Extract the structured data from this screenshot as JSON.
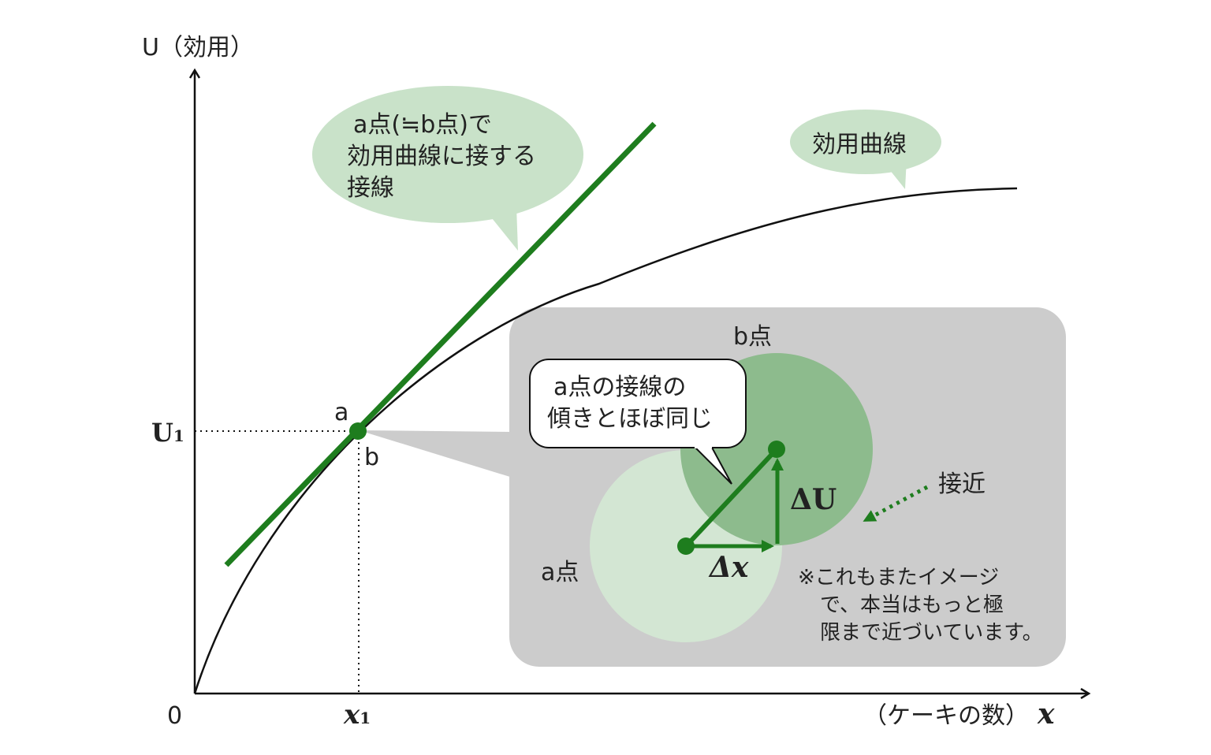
{
  "axes": {
    "y_label": "U（効用）",
    "x_label": "（ケーキの数）",
    "x_symbol": "x",
    "origin": "0",
    "u1_main": "U",
    "u1_sub": "1",
    "x1_main": "x",
    "x1_sub": "1"
  },
  "points": {
    "a": "a",
    "b": "b"
  },
  "callouts": {
    "tangent": [
      "a点(≒b点)で",
      "効用曲線に接する",
      "接線"
    ],
    "curve": "効用曲線",
    "slope": [
      "a点の接線の",
      "傾きとほぼ同じ"
    ]
  },
  "inset": {
    "b_point": "b点",
    "a_point": "a点",
    "delta_u": "ΔU",
    "delta_x": "Δx",
    "approach": "接近",
    "note": [
      "※これもまたイメージ",
      "で、本当はもっと極",
      "限まで近づいています。"
    ]
  },
  "colors": {
    "tangent_green": "#1e7d1e",
    "bubble_green": "#c9e2c9",
    "inset_gray": "#cccccc",
    "circle_b": "#8dbb8d",
    "circle_a": "#d3e6d3"
  }
}
